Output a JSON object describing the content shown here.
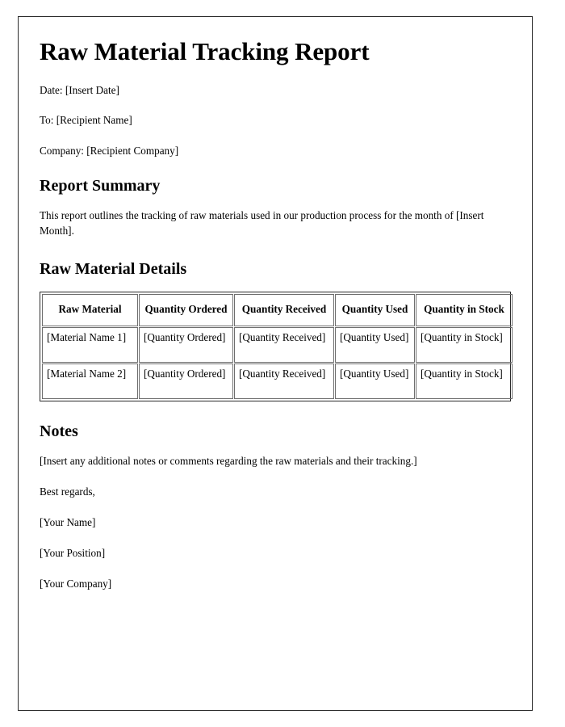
{
  "document": {
    "title": "Raw Material Tracking Report",
    "meta": [
      "Date: [Insert Date]",
      "To: [Recipient Name]",
      "Company: [Recipient Company]"
    ],
    "sections": {
      "summary": {
        "heading": "Report Summary",
        "paragraph": "This report outlines the tracking of raw materials used in our production process for the month of [Insert Month]."
      },
      "details": {
        "heading": "Raw Material Details",
        "table": {
          "columns": [
            "Raw Material",
            "Quantity Ordered",
            "Quantity Received",
            "Quantity Used",
            "Quantity in Stock"
          ],
          "rows": [
            [
              "[Material Name 1]",
              "[Quantity Ordered]",
              "[Quantity Received]",
              "[Quantity Used]",
              "[Quantity in Stock]"
            ],
            [
              "[Material Name 2]",
              "[Quantity Ordered]",
              "[Quantity Received]",
              "[Quantity Used]",
              "[Quantity in Stock]"
            ]
          ]
        }
      },
      "notes": {
        "heading": "Notes",
        "paragraphs": [
          "[Insert any additional notes or comments regarding the raw materials and their tracking.]",
          "Best regards,",
          "[Your Name]",
          "[Your Position]",
          "[Your Company]"
        ]
      }
    }
  },
  "colors": {
    "page_background": "#ffffff",
    "text": "#000000",
    "page_border": "#2b2b2b",
    "table_border": "#6e6e6e"
  }
}
